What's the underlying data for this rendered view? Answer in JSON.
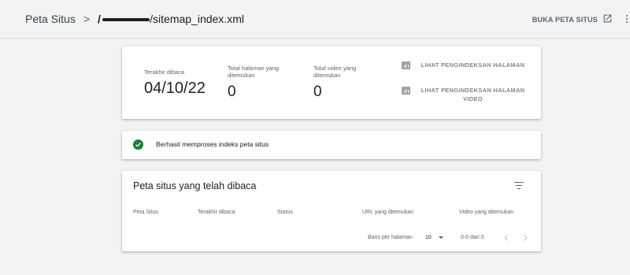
{
  "header": {
    "breadcrumb_root": "Peta Situs",
    "breadcrumb_separator": ">",
    "redacted_segment": "/",
    "sitemap_path": "/sitemap_index.xml",
    "open_sitemap_label": "BUKA PETA SITUS"
  },
  "summary": {
    "last_read_label": "Terakhir dibaca",
    "last_read_value": "04/10/22",
    "pages_found_label": "Total halaman yang ditemukan",
    "pages_found_value": "0",
    "videos_found_label": "Total video yang ditemukan",
    "videos_found_value": "0",
    "links": [
      {
        "label": "LIHAT PENGINDEKSAN HALAMAN",
        "icon": "bar-chart-icon"
      },
      {
        "label": "LIHAT PENGINDEKSAN HALAMAN VIDEO",
        "icon": "bar-chart-icon"
      }
    ]
  },
  "status": {
    "message": "Berhasil memproses indeks peta situs",
    "icon": "check-circle-icon",
    "color": "#188038"
  },
  "table": {
    "title": "Peta situs yang telah dibaca",
    "columns": [
      "Peta Situs",
      "Terakhir dibaca",
      "Status",
      "URL yang ditemukan",
      "Video yang ditemukan"
    ],
    "rows": [],
    "pagination": {
      "rows_per_page_label": "Baris per halaman",
      "rows_per_page_value": "10",
      "range_text": "0-0 dari 0"
    }
  },
  "colors": {
    "page_background": "#f1f3f4",
    "card_background": "#ffffff",
    "success": "#188038",
    "muted_text": "#5f6368"
  }
}
